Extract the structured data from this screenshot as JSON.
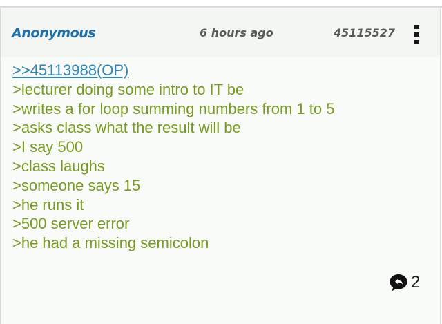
{
  "post": {
    "author": "Anonymous",
    "time": "6 hours ago",
    "number": "45115527",
    "quote_link": ">>45113988(OP)",
    "lines": [
      ">lecturer doing some intro to IT be",
      ">writes a for loop summing numbers from 1 to 5",
      ">asks class what the result will be",
      ">I say 500",
      ">class laughs",
      ">someone says 15",
      ">he runs it",
      ">500 server error",
      ">he had a missing semicolon"
    ],
    "reply_count": "2"
  },
  "icons": {
    "menu": "kebab-menu-icon",
    "reply": "reply-bubble-icon"
  },
  "colors": {
    "author": "#1f6fa8",
    "meta": "#555b55",
    "quote_link": "#2f86b3",
    "greentext": "#789922",
    "background": "#f8fbf8"
  }
}
